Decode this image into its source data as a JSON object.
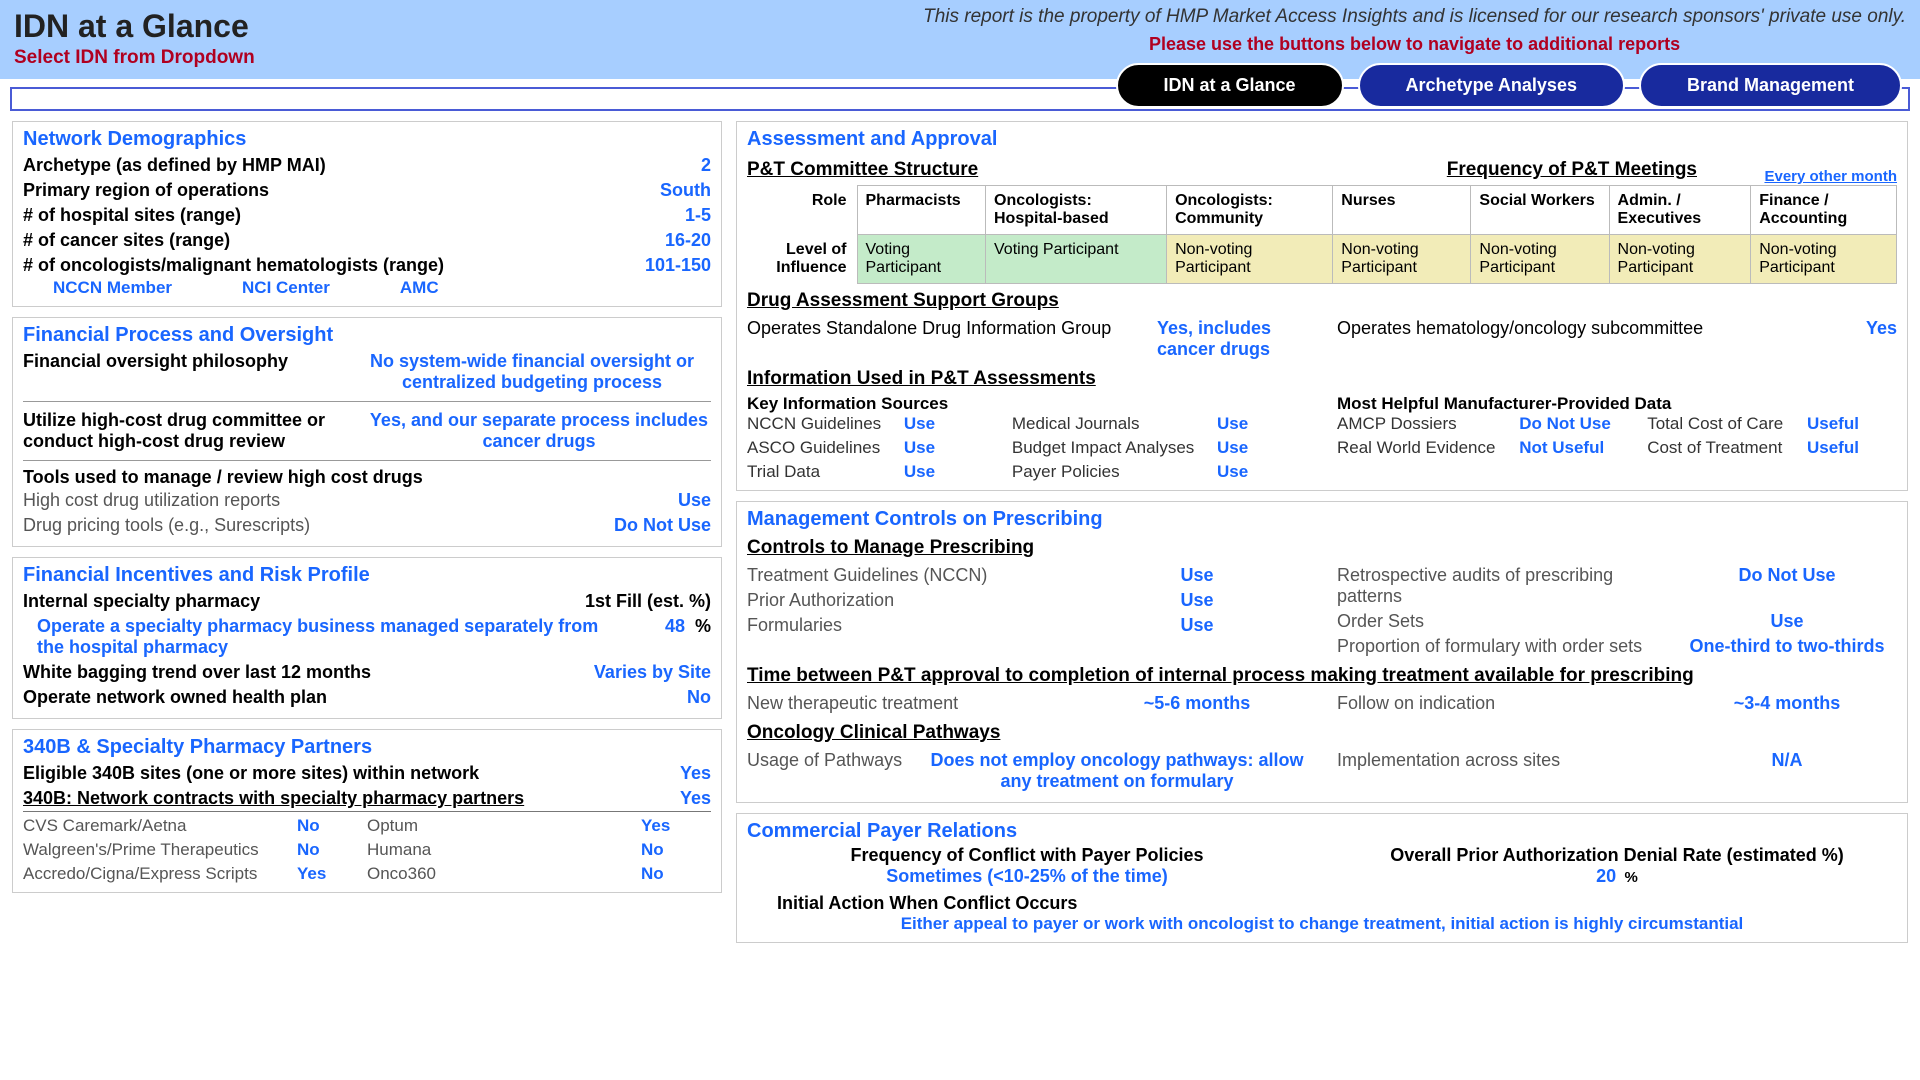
{
  "header": {
    "title": "IDN at a Glance",
    "subtitle": "Select IDN from Dropdown",
    "property_line": "This report is the property of HMP Market Access Insights and is licensed for our research sponsors' private use only.",
    "nav_hint": "Please use the buttons below to navigate to additional reports",
    "buttons": {
      "b1": "IDN at a Glance",
      "b2": "Archetype Analyses",
      "b3": "Brand Management"
    }
  },
  "net": {
    "title": "Network Demographics",
    "archetype_lbl": "Archetype (as defined by HMP MAI)",
    "archetype_val": "2",
    "region_lbl": "Primary region of operations",
    "region_val": "South",
    "hosp_lbl": "# of hospital sites (range)",
    "hosp_val": "1-5",
    "cancer_lbl": "# of cancer sites (range)",
    "cancer_val": "16-20",
    "onc_lbl": "# of oncologists/malignant hematologists (range)",
    "onc_val": "101-150",
    "badges": {
      "b1": "NCCN Member",
      "b2": "NCI Center",
      "b3": "AMC"
    }
  },
  "fin_proc": {
    "title": "Financial Process and Oversight",
    "phil_lbl": "Financial oversight philosophy",
    "phil_val": "No system-wide financial oversight or centralized budgeting process",
    "hc_lbl": "Utilize high-cost drug committee or conduct high-cost drug review",
    "hc_val": "Yes, and our separate process includes cancer drugs",
    "tools_lbl": "Tools used to manage / review high cost drugs",
    "t1_lbl": "High cost drug utilization reports",
    "t1_val": "Use",
    "t2_lbl": "Drug pricing tools (e.g., Surescripts)",
    "t2_val": "Do Not Use"
  },
  "fin_inc": {
    "title": "Financial Incentives and Risk Profile",
    "isp_lbl": "Internal specialty pharmacy",
    "isp_col": "1st Fill (est. %)",
    "op_lbl": "Operate a specialty pharmacy business managed separately from the hospital pharmacy",
    "op_val": "48",
    "op_unit": "%",
    "wb_lbl": "White bagging trend over last 12 months",
    "wb_val": "Varies by Site",
    "hp_lbl": "Operate network owned health plan",
    "hp_val": "No"
  },
  "s340": {
    "title": "340B & Specialty Pharmacy Partners",
    "elig_lbl": "Eligible 340B sites (one or more sites) within network",
    "elig_val": "Yes",
    "contracts_lbl": "340B: Network contracts with specialty pharmacy partners",
    "contracts_val": "Yes",
    "partners": {
      "p1": "CVS Caremark/Aetna",
      "v1": "No",
      "p2": "Optum",
      "v2": "Yes",
      "p3": "Walgreen's/Prime Therapeutics",
      "v3": "No",
      "p4": "Humana",
      "v4": "No",
      "p5": "Accredo/Cigna/Express Scripts",
      "v5": "Yes",
      "p6": "Onco360",
      "v6": "No"
    }
  },
  "assess": {
    "title": "Assessment and Approval",
    "pt_struct": "P&T Committee Structure",
    "freq_lbl": "Frequency of P&T Meetings",
    "freq_val": "Every other month",
    "row_role": "Role",
    "row_lvl": "Level of Influence",
    "cols": {
      "c1": "Pharmacists",
      "c2": "Oncologists: Hospital-based",
      "c3": "Oncologists: Community",
      "c4": "Nurses",
      "c5": "Social Workers",
      "c6": "Admin. / Executives",
      "c7": "Finance / Accounting"
    },
    "lvl": {
      "v1": "Voting Participant",
      "v2": "Voting Participant",
      "v3": "Non-voting Participant",
      "v4": "Non-voting Participant",
      "v5": "Non-voting Participant",
      "v6": "Non-voting Participant",
      "v7": "Non-voting Participant"
    },
    "dasg_h": "Drug Assessment Support Groups",
    "dig_lbl": "Operates Standalone Drug Information Group",
    "dig_val": "Yes, includes cancer drugs",
    "hem_lbl": "Operates hematology/oncology subcommittee",
    "hem_val": "Yes",
    "info_h": "Information Used in P&T Assessments",
    "key_h": "Key Information Sources",
    "mfg_h": "Most Helpful Manufacturer-Provided Data",
    "k": {
      "k1": "NCCN Guidelines",
      "u1": "Use",
      "k2": "Medical Journals",
      "u2": "Use",
      "k3": "ASCO Guidelines",
      "u3": "Use",
      "k4": "Budget Impact Analyses",
      "u4": "Use",
      "k5": "Trial Data",
      "u5": "Use",
      "k6": "Payer Policies",
      "u6": "Use"
    },
    "m": {
      "m1": "AMCP Dossiers",
      "mv1": "Do Not Use",
      "m2": "Total Cost of Care",
      "mv2": "Useful",
      "m3": "Real World Evidence",
      "mv3": "Not Useful",
      "m4": "Cost of Treatment",
      "mv4": "Useful"
    }
  },
  "mgmt": {
    "title": "Management Controls on Prescribing",
    "ctrl_h": "Controls to Manage Prescribing",
    "c": {
      "c1": "Treatment Guidelines (NCCN)",
      "v1": "Use",
      "c2": "Retrospective audits of prescribing patterns",
      "v2": "Do Not Use",
      "c3": "Prior Authorization",
      "v3": "Use",
      "c4": "Order Sets",
      "v4": "Use",
      "c5": "Formularies",
      "v5": "Use",
      "c6": "Proportion of formulary with order sets",
      "v6": "One-third to two-thirds"
    },
    "time_h": "Time between P&T approval to completion of internal process making treatment available for prescribing",
    "t1_lbl": "New therapeutic treatment",
    "t1_val": "~5-6 months",
    "t2_lbl": "Follow on indication",
    "t2_val": "~3-4 months",
    "path_h": "Oncology Clinical Pathways",
    "p1_lbl": "Usage of Pathways",
    "p1_val": "Does not employ oncology pathways: allow any treatment on formulary",
    "p2_lbl": "Implementation across sites",
    "p2_val": "N/A"
  },
  "payer": {
    "title": "Commercial Payer Relations",
    "freq_lbl": "Frequency of Conflict with Payer Policies",
    "freq_val": "Sometimes (<10-25% of the time)",
    "denial_lbl": "Overall Prior Authorization Denial Rate (estimated %)",
    "denial_val": "20",
    "denial_unit": "%",
    "init_lbl": "Initial Action When Conflict Occurs",
    "init_val": "Either appeal to payer or work with oncologist to change treatment, initial action is highly circumstantial"
  }
}
